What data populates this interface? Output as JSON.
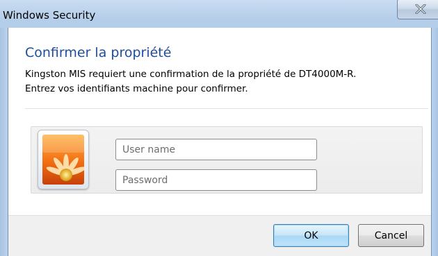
{
  "window": {
    "title": "Windows Security",
    "close_label": "X"
  },
  "dialog": {
    "heading": "Confirmer la propriété",
    "description_line1": "Kingston MIS requiert une confirmation de la propriété de DT4000M-R.",
    "description_line2": "Entrez vos identifiants machine pour confirmer."
  },
  "credentials": {
    "user_tile_icon": "user-flower-picture",
    "username": {
      "value": "",
      "placeholder": "User name"
    },
    "password": {
      "value": "",
      "placeholder": "Password"
    }
  },
  "buttons": {
    "ok_label": "OK",
    "cancel_label": "Cancel"
  },
  "colors": {
    "heading": "#1e4d9c",
    "frame": "#a9c5e6",
    "ok_border": "#3c7fb1"
  }
}
